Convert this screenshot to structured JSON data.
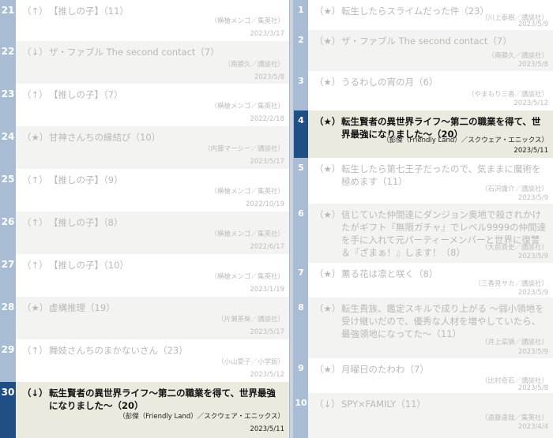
{
  "left_list": [
    {
      "rank": "21",
      "mark": "（↑）",
      "title": "【推しの子】（11）",
      "author": "（横槍メンゴ／集英社）",
      "date": "2023/3/17"
    },
    {
      "rank": "22",
      "mark": "（↓）",
      "title": "ザ・ファブル The second contact（7）",
      "author": "（南勝久／講談社）",
      "date": "2023/5/8"
    },
    {
      "rank": "23",
      "mark": "（↑）",
      "title": "【推しの子】（7）",
      "author": "（横槍メンゴ／集英社）",
      "date": "2022/2/18"
    },
    {
      "rank": "24",
      "mark": "（★）",
      "title": "甘神さんちの縁結び（10）",
      "author": "（内藤マーシー／講談社）",
      "date": "2023/5/17"
    },
    {
      "rank": "25",
      "mark": "（↑）",
      "title": "【推しの子】（9）",
      "author": "（横槍メンゴ／集英社）",
      "date": "2022/10/19"
    },
    {
      "rank": "26",
      "mark": "（↑）",
      "title": "【推しの子】（8）",
      "author": "（横槍メンゴ／集英社）",
      "date": "2022/6/17"
    },
    {
      "rank": "27",
      "mark": "（↑）",
      "title": "【推しの子】（10）",
      "author": "（横槍メンゴ／集英社）",
      "date": "2023/1/19"
    },
    {
      "rank": "28",
      "mark": "（★）",
      "title": "虚構推理（19）",
      "author": "（片瀬茶柴／講談社）",
      "date": "2023/5/17"
    },
    {
      "rank": "29",
      "mark": "（↑）",
      "title": "舞妓さんちのまかないさん（23）",
      "author": "（小山愛子／小学館）",
      "date": "2023/5/12"
    },
    {
      "rank": "30",
      "mark": "（↓）",
      "title": "転生賢者の異世界ライフ〜第二の職業を得て、世界最強になりました〜（20）",
      "author": "（彭傑（Friendly Land）／スクウェア・エニックス）",
      "date": "2023/5/11"
    }
  ],
  "right_list": [
    {
      "rank": "1",
      "mark": "（★）",
      "title": "転生したらスライムだった件（23）",
      "author": "（川上泰樹／講談社）",
      "date": "2023/5/9"
    },
    {
      "rank": "2",
      "mark": "（★）",
      "title": "ザ・ファブル The second contact（7）",
      "author": "（南勝久／講談社）",
      "date": "2023/5/8"
    },
    {
      "rank": "3",
      "mark": "（★）",
      "title": "うるわしの宵の月（6）",
      "author": "（やまもり三香／講談社）",
      "date": "2023/5/12"
    },
    {
      "rank": "4",
      "mark": "（★）",
      "title": "転生賢者の異世界ライフ〜第二の職業を得て、世界最強になりました〜（20）",
      "author": "（彭傑（Friendly Land）／スクウェア・エニックス）",
      "date": "2023/5/11"
    },
    {
      "rank": "5",
      "mark": "（★）",
      "title": "転生したら第七王子だったので、気ままに魔術を極めます（11）",
      "author": "（石沢庸介／講談社）",
      "date": "2023/5/9"
    },
    {
      "rank": "6",
      "mark": "（★）",
      "title": "信じていた仲間達にダンジョン奥地で殺されかけたがギフト『無限ガチャ』でレベル9999の仲間達を手に入れて元パーティーメンバーと世界に復讐＆『ざまぁ！』します！（8）",
      "author": "（大前貴史／講談社）",
      "date": "2023/5/9"
    },
    {
      "rank": "7",
      "mark": "（★）",
      "title": "薫る花は凛と咲く（8）",
      "author": "（三香見サカ／講談社）",
      "date": "2023/5/9"
    },
    {
      "rank": "8",
      "mark": "（★）",
      "title": "転生貴族、鑑定スキルで成り上がる 〜弱小領地を受け継いだので、優秀な人材を増やしていたら、最強領地になってた〜（11）",
      "author": "（井上菜摘／講談社）",
      "date": "2023/5/9"
    },
    {
      "rank": "9",
      "mark": "（★）",
      "title": "月曜日のたわわ（7）",
      "author": "（比村奇石／講談社）",
      "date": "2023/5/8"
    },
    {
      "rank": "10",
      "mark": "（↓）",
      "title": "SPY×FAMILY（11）",
      "author": "（遠藤達哉／集英社）",
      "date": "2023/4/4"
    }
  ]
}
